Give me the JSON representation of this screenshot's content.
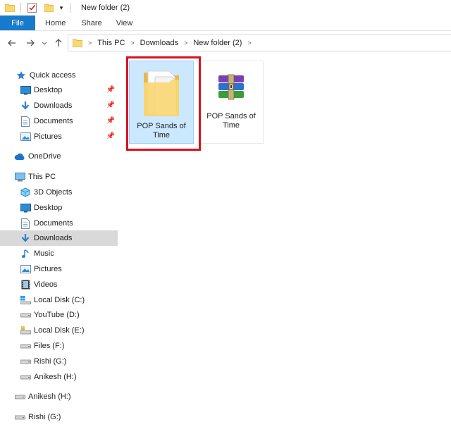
{
  "window": {
    "title": "New folder (2)"
  },
  "ribbon": {
    "file": "File",
    "home": "Home",
    "share": "Share",
    "view": "View"
  },
  "address": {
    "crumbs": [
      "This PC",
      "Downloads",
      "New folder (2)"
    ]
  },
  "sidebar": {
    "items": [
      {
        "label": "Quick access",
        "icon": "star-icon"
      },
      {
        "label": "Desktop",
        "icon": "desktop-icon",
        "pinned": true
      },
      {
        "label": "Downloads",
        "icon": "download-arrow-icon",
        "pinned": true
      },
      {
        "label": "Documents",
        "icon": "document-icon",
        "pinned": true
      },
      {
        "label": "Pictures",
        "icon": "pictures-icon",
        "pinned": true
      },
      {
        "label": "OneDrive",
        "icon": "cloud-icon"
      },
      {
        "label": "This PC",
        "icon": "computer-icon"
      },
      {
        "label": "3D Objects",
        "icon": "cube-icon"
      },
      {
        "label": "Desktop",
        "icon": "desktop-icon"
      },
      {
        "label": "Documents",
        "icon": "document-icon"
      },
      {
        "label": "Downloads",
        "icon": "download-arrow-icon",
        "selected": true
      },
      {
        "label": "Music",
        "icon": "music-note-icon"
      },
      {
        "label": "Pictures",
        "icon": "pictures-icon"
      },
      {
        "label": "Videos",
        "icon": "film-icon"
      },
      {
        "label": "Local Disk (C:)",
        "icon": "windows-drive-icon"
      },
      {
        "label": "YouTube (D:)",
        "icon": "drive-icon"
      },
      {
        "label": "Local Disk (E:)",
        "icon": "locked-drive-icon"
      },
      {
        "label": "Files (F:)",
        "icon": "drive-icon"
      },
      {
        "label": "Rishi (G:)",
        "icon": "drive-icon"
      },
      {
        "label": "Anikesh (H:)",
        "icon": "drive-icon"
      },
      {
        "label": "Anikesh (H:)",
        "icon": "drive-icon"
      },
      {
        "label": "Rishi (G:)",
        "icon": "drive-icon"
      }
    ]
  },
  "content": {
    "items": [
      {
        "label": "POP Sands of Time",
        "icon": "folder-icon",
        "selected": true
      },
      {
        "label": "POP Sands of Time",
        "icon": "winrar-archive-icon"
      }
    ]
  },
  "colors": {
    "accent": "#1979ca",
    "highlight": "#d9121b",
    "selection": "#cce8ff",
    "folder": "#f8d775"
  }
}
